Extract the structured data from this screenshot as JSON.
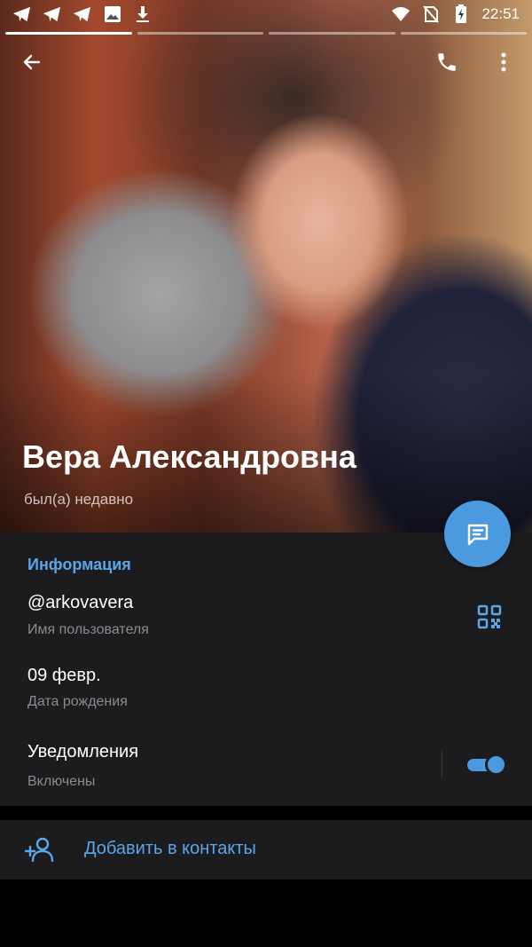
{
  "status_bar": {
    "time": "22:51",
    "left_icons": [
      "telegram-icon",
      "telegram-icon",
      "telegram-icon",
      "image-icon",
      "download-icon"
    ],
    "right_icons": [
      "wifi-icon",
      "no-sim-icon",
      "battery-charging-icon"
    ]
  },
  "profile": {
    "name": "Вера Александровна",
    "last_seen": "был(а) недавно",
    "story_segments": 4,
    "active_segment": 0
  },
  "info": {
    "section_title": "Информация",
    "username": "@arkovavera",
    "username_label": "Имя пользователя",
    "birthday": "09 февр.",
    "birthday_label": "Дата рождения",
    "notifications": "Уведомления",
    "notifications_state": "Включены",
    "notifications_enabled": true
  },
  "actions": {
    "add_contact": "Добавить в контакты"
  },
  "colors": {
    "accent": "#4b9adf",
    "link_text": "#5aa6e9",
    "panel": "#1c1c1e",
    "secondary_text": "#8b8b8f"
  }
}
